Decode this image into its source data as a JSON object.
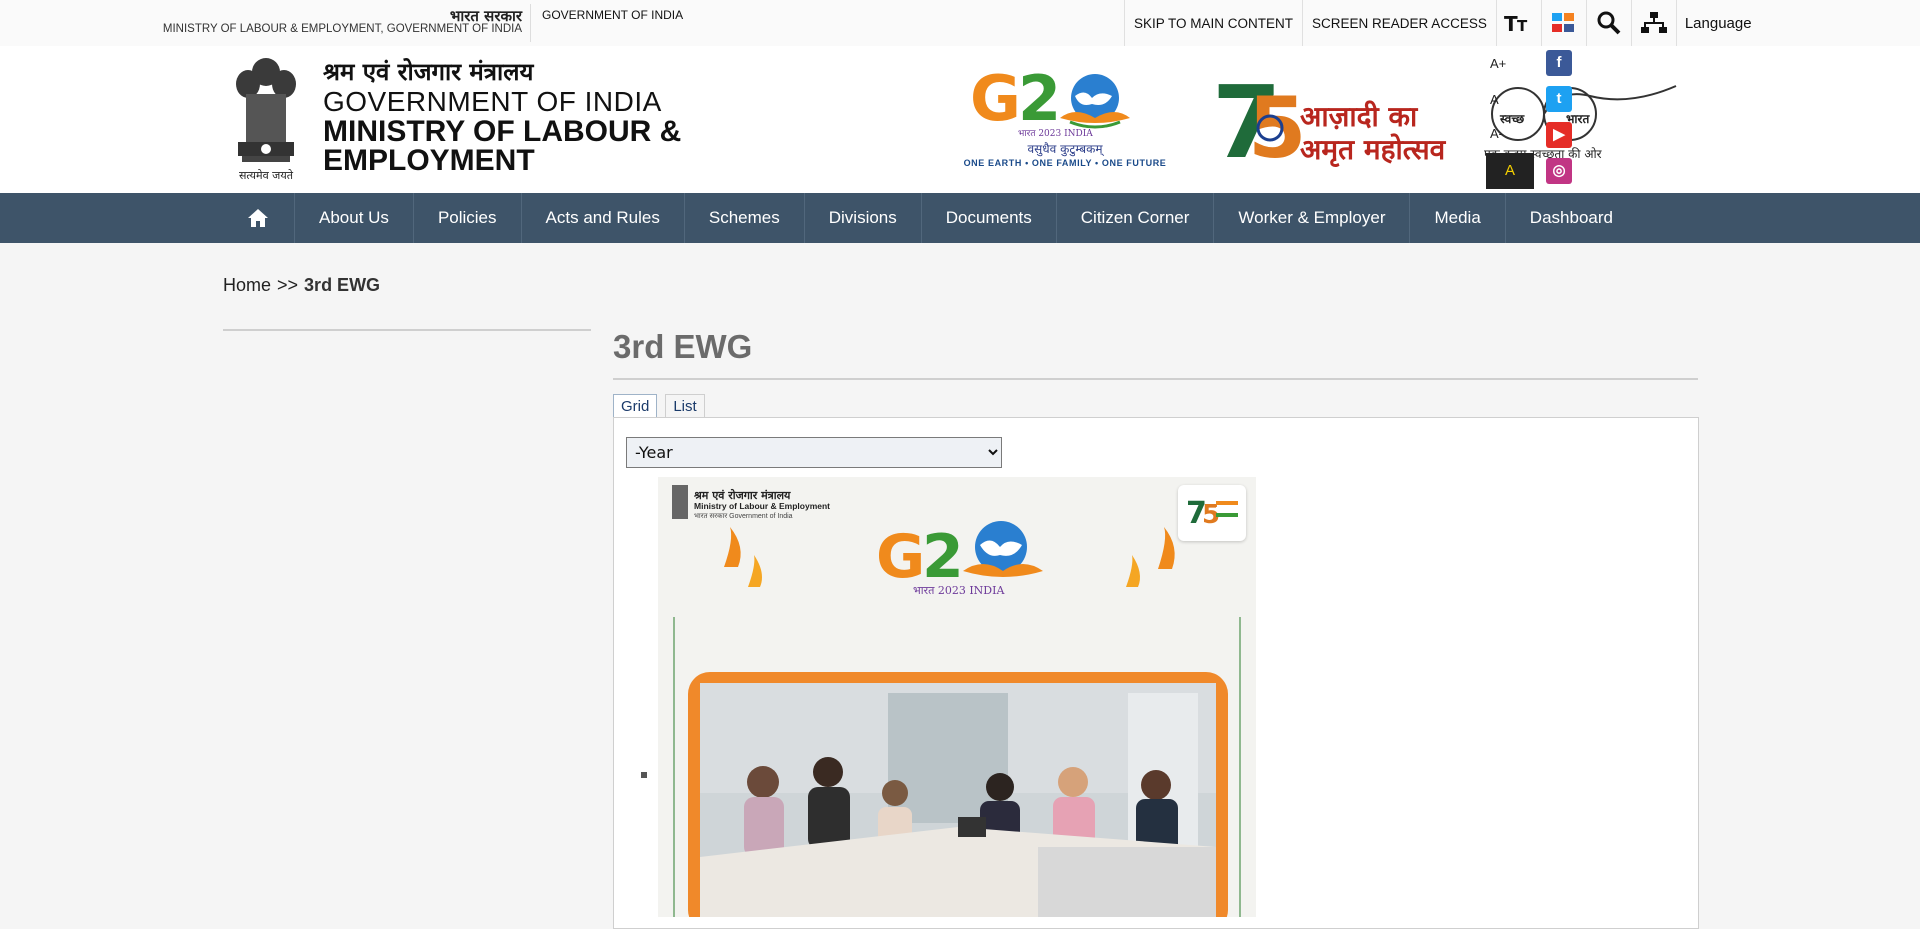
{
  "topbar": {
    "gov_hindi": "भारत सरकार",
    "gov_english_small": "MINISTRY OF LABOUR & EMPLOYMENT, GOVERNMENT OF INDIA",
    "gov_india": "GOVERNMENT OF INDIA",
    "skip_link": "SKIP TO MAIN CONTENT",
    "screen_reader": "SCREEN READER ACCESS",
    "language": "Language",
    "icons": [
      "text-size-icon",
      "social-media-icon",
      "search-icon",
      "sitemap-icon"
    ]
  },
  "header": {
    "emblem_caption": "सत्यमेव जयते",
    "title_hindi": "श्रम एवं रोजगार मंत्रालय",
    "title_goi": "GOVERNMENT OF INDIA",
    "title_ministry_line1": "MINISTRY OF LABOUR &",
    "title_ministry_line2": "EMPLOYMENT",
    "g20_tagline": "ONE EARTH • ONE FAMILY • ONE FUTURE",
    "g20_motto": "वसुधैव कुटुम्बकम्",
    "azadi_text_line1": "आज़ादी का",
    "azadi_text_line2": "अमृत महोत्सव",
    "swachh_word1": "स्वच्छ",
    "swachh_word2": "भारत",
    "swachh_caption": "एक कदम स्वच्छता की ओर"
  },
  "accessibility": {
    "font_increase": "A+",
    "font_normal": "A",
    "font_decrease": "A-",
    "contrast": "A"
  },
  "social": {
    "facebook": "f",
    "twitter": "t",
    "youtube": "▶",
    "instagram": "◎"
  },
  "nav": {
    "items": [
      {
        "label": "About Us"
      },
      {
        "label": "Policies"
      },
      {
        "label": "Acts and Rules"
      },
      {
        "label": "Schemes"
      },
      {
        "label": "Divisions"
      },
      {
        "label": "Documents"
      },
      {
        "label": "Citizen Corner"
      },
      {
        "label": "Worker & Employer"
      },
      {
        "label": "Media"
      },
      {
        "label": "Dashboard"
      }
    ]
  },
  "breadcrumb": {
    "home": "Home",
    "separator": ">>",
    "current": "3rd EWG"
  },
  "main": {
    "title": "3rd EWG",
    "tabs": [
      {
        "label": "Grid"
      },
      {
        "label": "List"
      }
    ],
    "year_select": "-Year"
  },
  "photo": {
    "ministry_hindi": "श्रम एवं रोजगार मंत्रालय",
    "ministry_english": "Ministry of Labour & Employment",
    "government": "भारत सरकार  Government of India",
    "india_label": "भारत 2023 INDIA"
  },
  "colors": {
    "nav_bg": "#3e5469",
    "title_gray": "#6b6b6b",
    "azadi_red": "#b8261e",
    "g20_orange": "#f08a1c",
    "g20_green": "#3a9a36",
    "frame_orange": "#f0892a"
  }
}
